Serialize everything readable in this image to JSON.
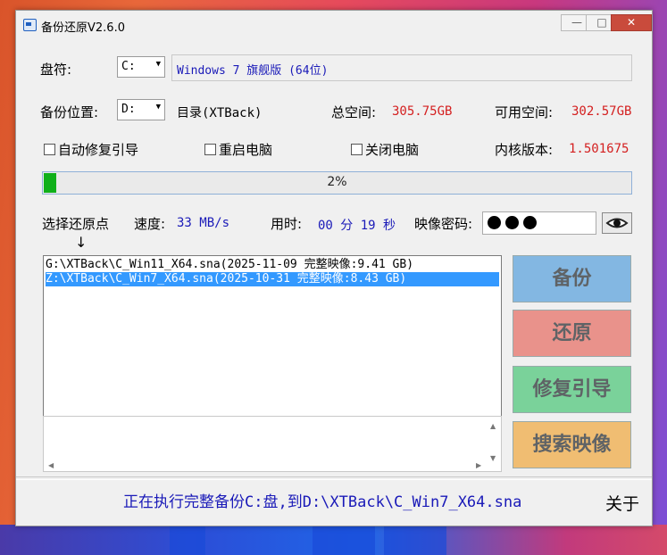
{
  "window": {
    "title": "备份还原V2.6.0",
    "minimize": "—",
    "maximize": "□",
    "close": "✕"
  },
  "drive": {
    "label": "盘符:",
    "value": "C:",
    "os_info": "Windows 7 旗舰版 (64位)"
  },
  "backup_location": {
    "label": "备份位置:",
    "value": "D:",
    "directory": "目录(XTBack)",
    "total_space_label": "总空间:",
    "total_space": "305.75GB",
    "free_space_label": "可用空间:",
    "free_space": "302.57GB"
  },
  "options": {
    "auto_repair_boot": "自动修复引导",
    "restart": "重启电脑",
    "shutdown": "关闭电脑",
    "kernel_label": "内核版本:",
    "kernel_version": "1.501675"
  },
  "progress": {
    "percent_text": "2%",
    "fraction": 0.02
  },
  "stats": {
    "select_restore_label": "选择还原点",
    "arrow": "↓",
    "speed_label": "速度:",
    "speed_value": "33 MB/s",
    "time_label": "用时:",
    "time_value": "00 分 19 秒",
    "password_label": "映像密码:"
  },
  "restore_points": [
    {
      "text": "G:\\XTBack\\C_Win11_X64.sna(2025-11-09 完整映像:9.41 GB)",
      "selected": false
    },
    {
      "text": "Z:\\XTBack\\C_Win7_X64.sna(2025-10-31 完整映像:8.43 GB)",
      "selected": true
    }
  ],
  "buttons": {
    "backup": "备份",
    "restore": "还原",
    "repair_boot": "修复引导",
    "search_image": "搜索映像"
  },
  "status_text": "正在执行完整备份C:盘,到D:\\XTBack\\C_Win7_X64.sna",
  "about": "关于",
  "colors": {
    "progress_fill": "#10b01a",
    "accent_blue": "#1a1ab8",
    "accent_red": "#d42020",
    "selection": "#3399ff"
  }
}
